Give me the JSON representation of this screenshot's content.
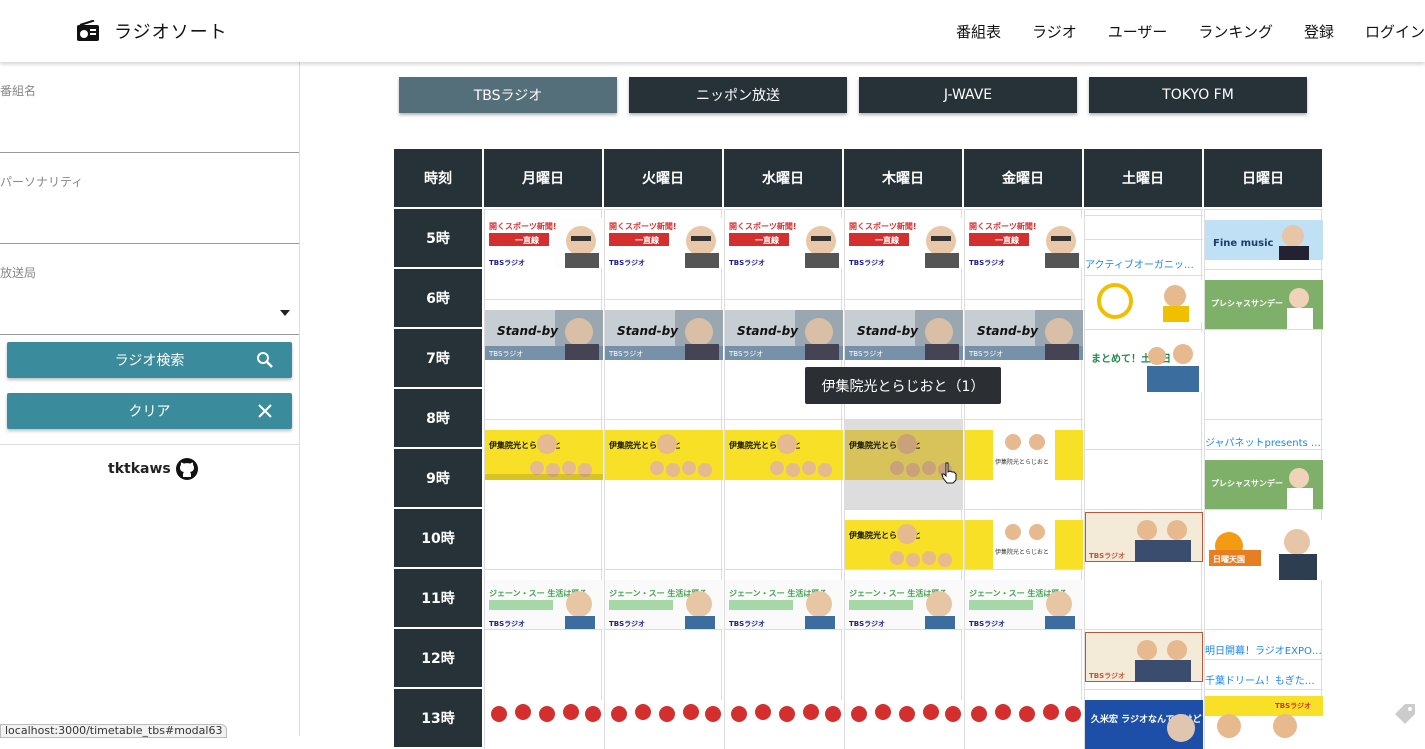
{
  "app": {
    "title": "ラジオソート",
    "icon": "radio-icon"
  },
  "nav": [
    "番組表",
    "ラジオ",
    "ユーザー",
    "ランキング",
    "登録",
    "ログイン"
  ],
  "search": {
    "fields": [
      {
        "label": "番組名",
        "value": ""
      },
      {
        "label": "パーソナリティ",
        "value": ""
      },
      {
        "label": "放送局",
        "value": ""
      }
    ],
    "search_button": "ラジオ検索",
    "clear_button": "クリア"
  },
  "credit": {
    "name": "tktkaws",
    "icon": "github-icon"
  },
  "statusbar_url": "localhost:3000/timetable_tbs#modal63",
  "stations": [
    "TBSラジオ",
    "ニッポン放送",
    "J-WAVE",
    "TOKYO FM"
  ],
  "active_station": 0,
  "timetable": {
    "corner": "時刻",
    "days": [
      "月曜日",
      "火曜日",
      "水曜日",
      "木曜日",
      "金曜日",
      "土曜日",
      "日曜日"
    ],
    "hours": [
      "5時",
      "6時",
      "7時",
      "8時",
      "9時",
      "10時",
      "11時",
      "12時",
      "13時"
    ],
    "texts": {
      "sat_5": "アクティブオーガニック…",
      "sun_8": "ジャパネットpresents …",
      "sun_12a": "明日開幕！ラジオEXPO…",
      "sun_12b": "千葉ドリーム！もぎたて…"
    },
    "thumb_texts": {
      "morning": "開くスポーツ新聞!",
      "morning_title": "一直線",
      "standby": "Stand-by",
      "ijuin": "伊集院光とらじおと",
      "jane": "ジェーン・スー 生活は踊る",
      "fine": "Fine music",
      "precious": "プレシャスサンデー",
      "matomete": "まとめて！土曜日",
      "nichiyo": "日曜天国",
      "kumegahiro": "久米宏 ラジオなんですけど",
      "tbs": "TBSラジオ"
    }
  },
  "tooltip": "伊集院光とらじおと（1）",
  "colors": {
    "header_bg": "#263238",
    "active_tab": "#546e7a",
    "button": "#3a8c9c",
    "link": "#1e88e5"
  }
}
